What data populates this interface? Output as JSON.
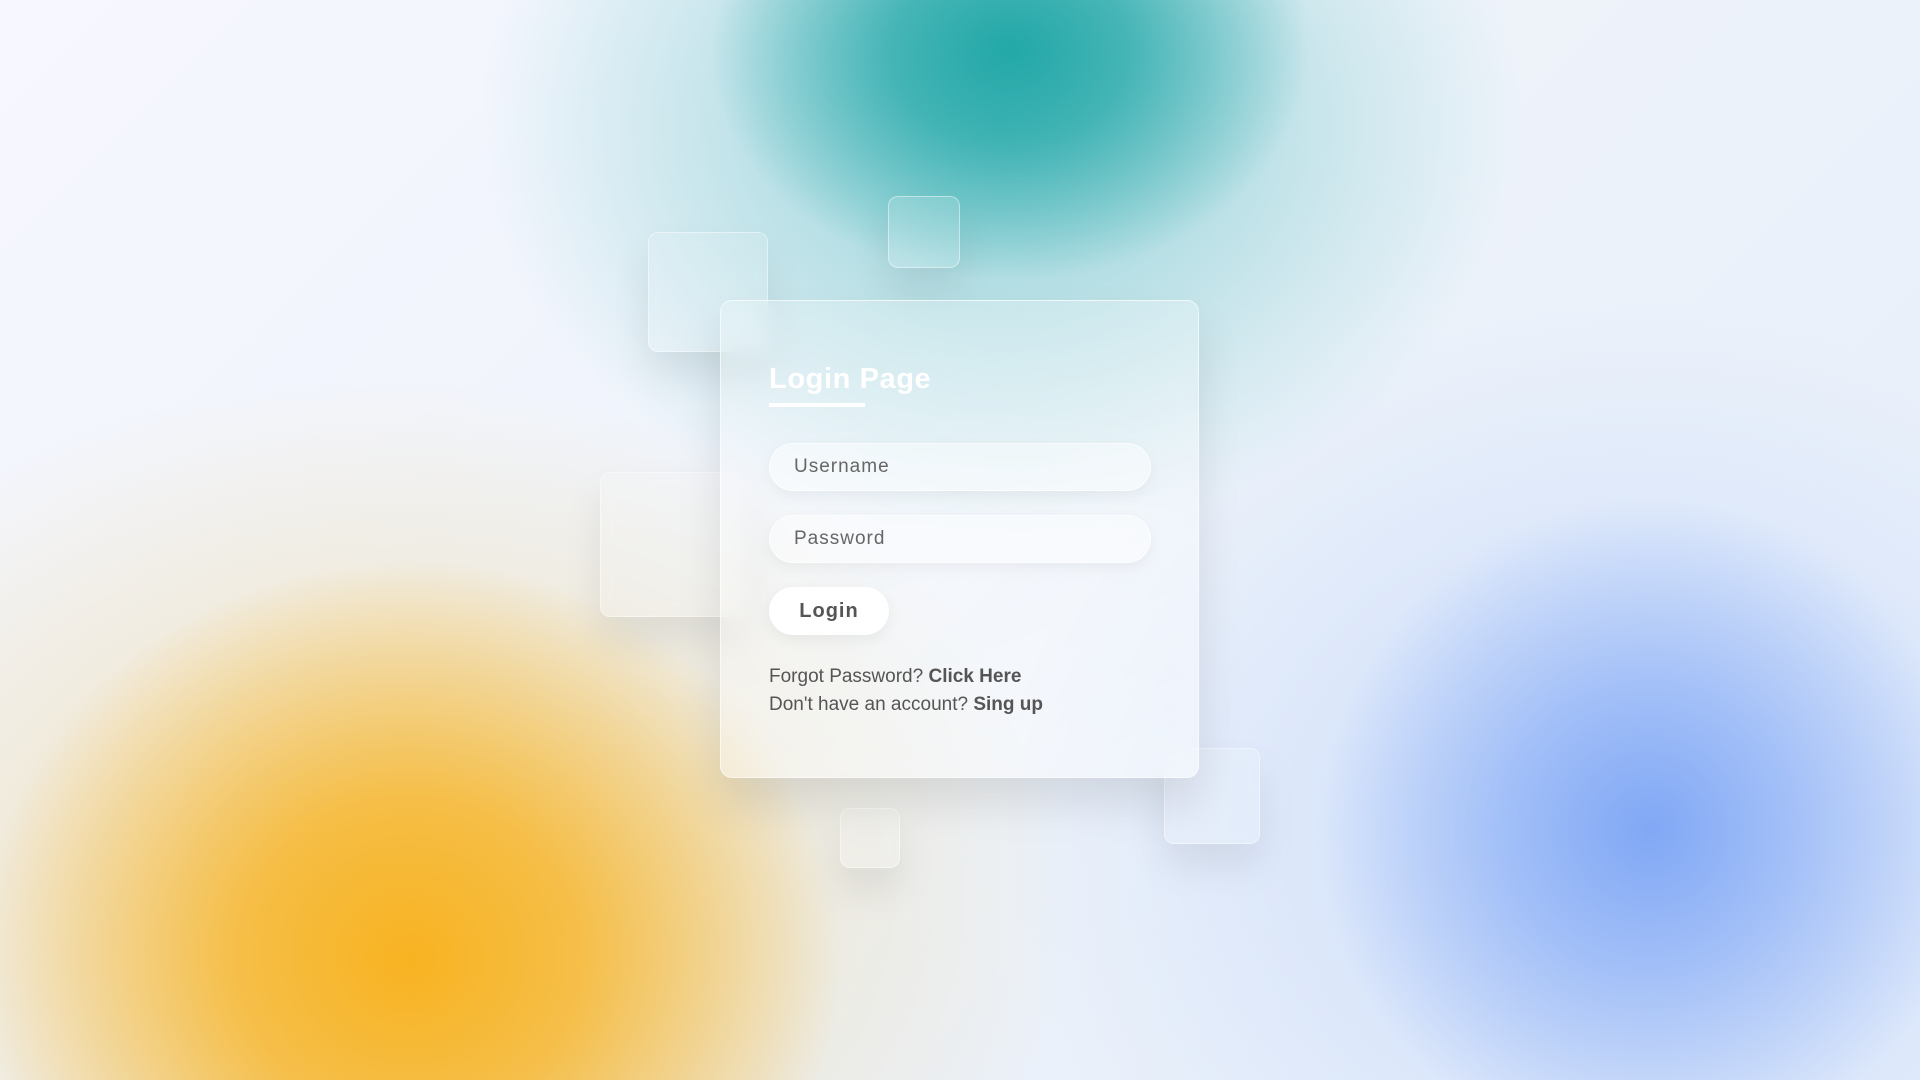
{
  "login_form": {
    "title": "Login Page",
    "username_placeholder": "Username",
    "password_placeholder": "Password",
    "login_button_label": "Login",
    "forgot_password_text": "Forgot Password?",
    "forgot_password_link": "Click Here",
    "no_account_text": "Don't have an account?",
    "signup_link": "Sing up"
  },
  "colors": {
    "teal_blob": "#1ca5a5",
    "orange_blob": "#f8b21e",
    "blue_blob": "#7da5f5",
    "text": "#555555",
    "title": "#ffffff"
  }
}
